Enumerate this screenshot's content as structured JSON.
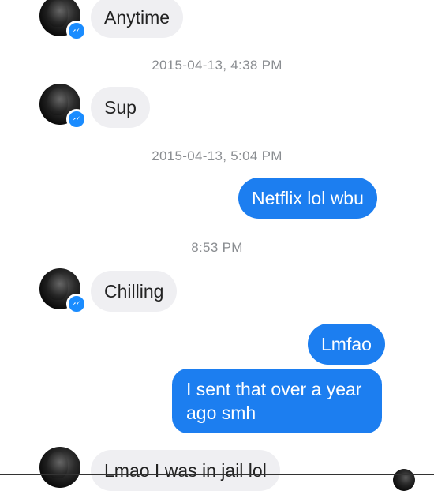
{
  "messages": [
    {
      "text": "Anytime"
    },
    {
      "text": "Sup"
    },
    {
      "text": "Netflix lol wbu"
    },
    {
      "text": "Chilling"
    },
    {
      "text": "Lmfao"
    },
    {
      "text": "I sent that over a year ago smh"
    },
    {
      "text": "Lmao I was in jail lol"
    }
  ],
  "timestamps": [
    "2015-04-13, 4:38 PM",
    "2015-04-13, 5:04 PM",
    "8:53 PM"
  ],
  "icons": {
    "badge": "messenger-badge-icon",
    "avatar": "contact-avatar"
  },
  "colors": {
    "outgoing_bubble": "#1c7ef0",
    "incoming_bubble": "#efeff2",
    "badge": "#1a8cff"
  }
}
